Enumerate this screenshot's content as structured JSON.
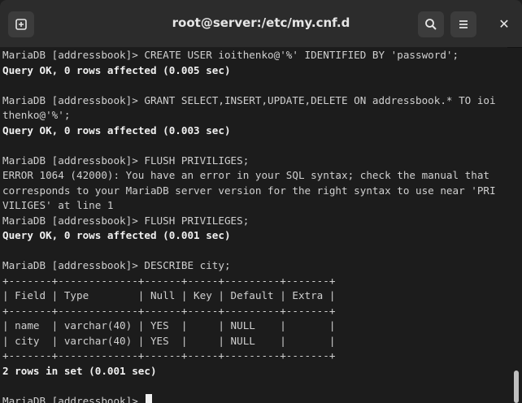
{
  "window": {
    "title": "root@server:/etc/my.cnf.d"
  },
  "header": {
    "new_tab_icon": "new-tab-icon",
    "search_icon": "search-icon",
    "menu_icon": "hamburger-menu-icon",
    "close_icon": "close-icon",
    "close_glyph": "✕"
  },
  "terminal": {
    "lines": [
      {
        "text": "MariaDB [addressbook]> CREATE USER ioithenko@'%' IDENTIFIED BY 'password';",
        "bold": false
      },
      {
        "text": "Query OK, 0 rows affected (0.005 sec)",
        "bold": true
      },
      {
        "text": "",
        "bold": false
      },
      {
        "text": "MariaDB [addressbook]> GRANT SELECT,INSERT,UPDATE,DELETE ON addressbook.* TO ioi",
        "bold": false
      },
      {
        "text": "thenko@'%';",
        "bold": false
      },
      {
        "text": "Query OK, 0 rows affected (0.003 sec)",
        "bold": true
      },
      {
        "text": "",
        "bold": false
      },
      {
        "text": "MariaDB [addressbook]> FLUSH PRIVILIGES;",
        "bold": false
      },
      {
        "text": "ERROR 1064 (42000): You have an error in your SQL syntax; check the manual that",
        "bold": false
      },
      {
        "text": "corresponds to your MariaDB server version for the right syntax to use near 'PRI",
        "bold": false
      },
      {
        "text": "VILIGES' at line 1",
        "bold": false
      },
      {
        "text": "MariaDB [addressbook]> FLUSH PRIVILEGES;",
        "bold": false
      },
      {
        "text": "Query OK, 0 rows affected (0.001 sec)",
        "bold": true
      },
      {
        "text": "",
        "bold": false
      },
      {
        "text": "MariaDB [addressbook]> DESCRIBE city;",
        "bold": false
      },
      {
        "text": "+-------+-------------+------+-----+---------+-------+",
        "bold": false
      },
      {
        "text": "| Field | Type        | Null | Key | Default | Extra |",
        "bold": false
      },
      {
        "text": "+-------+-------------+------+-----+---------+-------+",
        "bold": false
      },
      {
        "text": "| name  | varchar(40) | YES  |     | NULL    |       |",
        "bold": false
      },
      {
        "text": "| city  | varchar(40) | YES  |     | NULL    |       |",
        "bold": false
      },
      {
        "text": "+-------+-------------+------+-----+---------+-------+",
        "bold": false
      },
      {
        "text": "2 rows in set (0.001 sec)",
        "bold": true
      },
      {
        "text": "",
        "bold": false
      },
      {
        "text": "MariaDB [addressbook]> ",
        "bold": false
      }
    ]
  }
}
